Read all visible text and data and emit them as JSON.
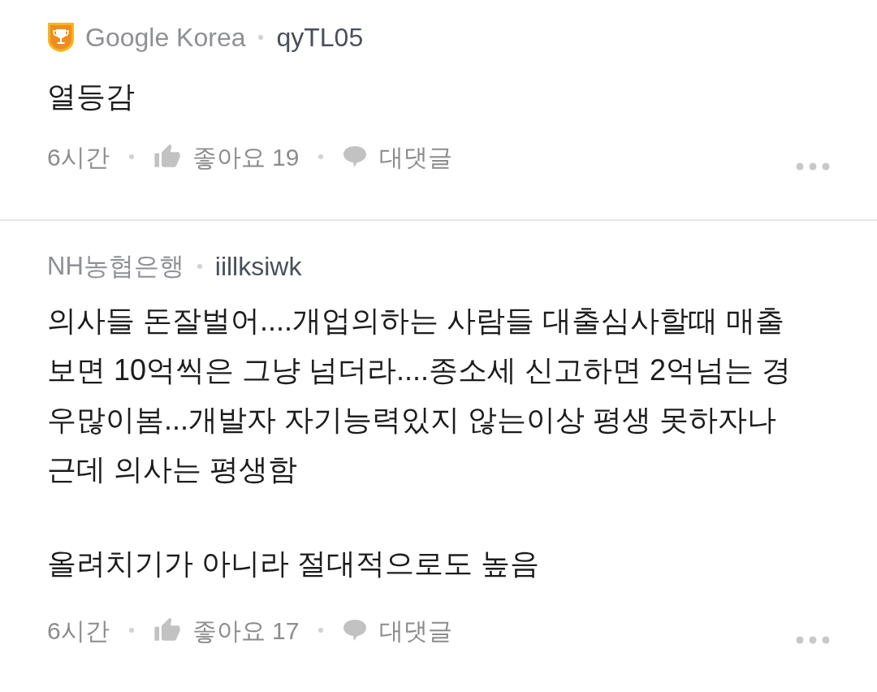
{
  "comments": [
    {
      "badge": true,
      "affiliation": "Google Korea",
      "username": "qyTL05",
      "paragraphs": [
        [
          "열등감"
        ]
      ],
      "time": "6시간",
      "likes": "좋아요 19",
      "reply": "대댓글"
    },
    {
      "badge": false,
      "affiliation": "NH농협은행",
      "username": "iillksiwk",
      "paragraphs": [
        [
          "의사들 돈잘벌어....개업의하는 사람들 대출심사할때 매출",
          "보면 10억씩은 그냥 넘더라....종소세 신고하면 2억넘는 경",
          "우많이봄...개발자 자기능력있지 않는이상 평생 못하자나",
          "근데 의사는 평생함"
        ],
        [
          "올려치기가 아니라 절대적으로도 높음"
        ]
      ],
      "time": "6시간",
      "likes": "좋아요 17",
      "reply": "대댓글"
    }
  ]
}
